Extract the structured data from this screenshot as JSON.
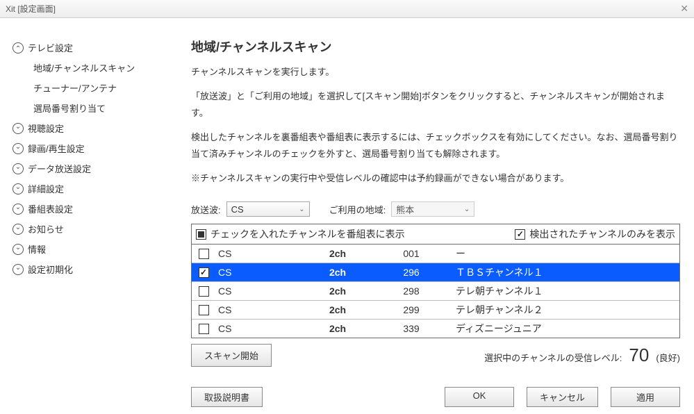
{
  "window": {
    "title": "Xit [設定画面]"
  },
  "sidebar": {
    "items": [
      {
        "label": "テレビ設定",
        "open": true,
        "children": [
          {
            "label": "地域/チャンネルスキャン"
          },
          {
            "label": "チューナー/アンテナ"
          },
          {
            "label": "選局番号割り当て"
          }
        ]
      },
      {
        "label": "視聴設定"
      },
      {
        "label": "録画/再生設定"
      },
      {
        "label": "データ放送設定"
      },
      {
        "label": "詳細設定"
      },
      {
        "label": "番組表設定"
      },
      {
        "label": "お知らせ"
      },
      {
        "label": "情報"
      },
      {
        "label": "設定初期化"
      }
    ]
  },
  "content": {
    "heading": "地域/チャンネルスキャン",
    "intro": "チャンネルスキャンを実行します。",
    "desc1": "「放送波」と「ご利用の地域」を選択して[スキャン開始]ボタンをクリックすると、チャンネルスキャンが開始されます。",
    "desc2": "検出したチャンネルを裏番組表や番組表に表示するには、チェックボックスを有効にしてください。なお、選局番号割り当て済みチャンネルのチェックを外すと、選局番号割り当ても解除されます。",
    "note": "※チャンネルスキャンの実行中や受信レベルの確認中は予約録画ができない場合があります。",
    "broadcast_label": "放送波:",
    "broadcast_value": "CS",
    "region_label": "ご利用の地域:",
    "region_value": "熊本",
    "header_check_label": "チェックを入れたチャンネルを番組表に表示",
    "header_detected_label": "検出されたチャンネルのみを表示",
    "rows": [
      {
        "checked": false,
        "type": "CS",
        "ch": "2ch",
        "num": "001",
        "name": "ー",
        "selected": false
      },
      {
        "checked": true,
        "type": "CS",
        "ch": "2ch",
        "num": "296",
        "name": "ＴＢＳチャンネル１",
        "selected": true
      },
      {
        "checked": false,
        "type": "CS",
        "ch": "2ch",
        "num": "298",
        "name": "テレ朝チャンネル１",
        "selected": false
      },
      {
        "checked": false,
        "type": "CS",
        "ch": "2ch",
        "num": "299",
        "name": "テレ朝チャンネル２",
        "selected": false
      },
      {
        "checked": false,
        "type": "CS",
        "ch": "2ch",
        "num": "339",
        "name": "ディズニージュニア",
        "selected": false
      }
    ],
    "scan_button": "スキャン開始",
    "signal_label": "選択中のチャンネルの受信レベル:",
    "signal_value": "70",
    "signal_quality": "(良好)"
  },
  "buttons": {
    "manual": "取扱説明書",
    "ok": "OK",
    "cancel": "キャンセル",
    "apply": "適用"
  }
}
